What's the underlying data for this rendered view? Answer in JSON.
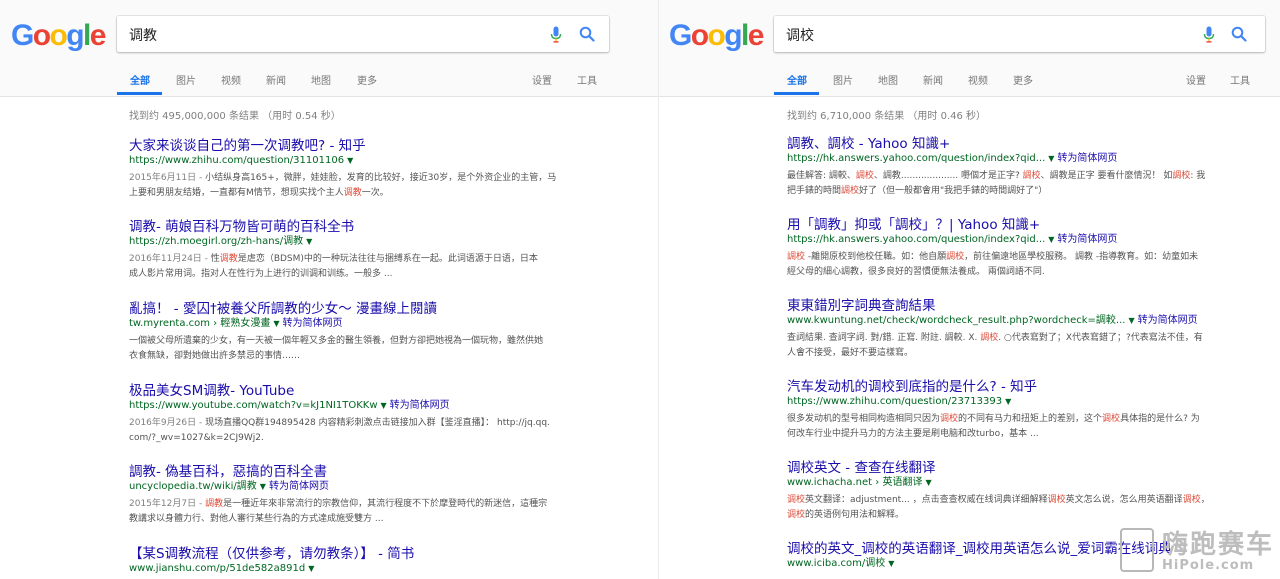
{
  "brand": {
    "logo_letters": [
      "G",
      "o",
      "o",
      "g",
      "l",
      "e"
    ],
    "logo_colors": [
      "#4285f4",
      "#ea4335",
      "#fbbc05",
      "#4285f4",
      "#34a853",
      "#ea4335"
    ],
    "accent": "#1a73e8",
    "link_color": "#1a0dab",
    "url_color": "#006621",
    "highlight_color": "#dd4b39"
  },
  "left": {
    "query": "调教",
    "tabs": [
      "全部",
      "图片",
      "视频",
      "新闻",
      "地图",
      "更多"
    ],
    "settings": "设置",
    "tools": "工具",
    "stats": "找到约 495,000,000 条结果 （用时 0.54 秒）",
    "results": [
      {
        "title": "大家来谈谈自己的第一次调教吧? - 知乎",
        "url": "https://www.zhihu.com/question/31101106",
        "translate": "",
        "date": "2015年6月11日 - ",
        "snippet_lines": [
          [
            {
              "t": "小结纵身高165+，微胖，娃娃脸，发育的比较好，接近30岁，是个外资企业的主管，马"
            }
          ],
          [
            {
              "t": "上要和男朋友结婚，一直都有M情节，想现实找个主人"
            },
            {
              "t": "调教",
              "h": true
            },
            {
              "t": "一次。"
            }
          ]
        ]
      },
      {
        "title": "调教- 萌娘百科万物皆可萌的百科全书",
        "url": "https://zh.moegirl.org/zh-hans/调教",
        "translate": "",
        "date": "2016年11月24日 - ",
        "snippet_lines": [
          [
            {
              "t": "性"
            },
            {
              "t": "调教",
              "h": true
            },
            {
              "t": "是虐恋（BDSM)中的一种玩法往往与捆缚系在一起。此词语源于日语，日本"
            }
          ],
          [
            {
              "t": "成人影片常用词。指对人在性行为上进行的训调和训练。一般多 ..."
            }
          ]
        ]
      },
      {
        "title": "亂搞！ - 愛囚†被養父所調教的少女～ 漫畫線上閱讀",
        "url": "tw.myrenta.com › 輕熟女漫畫",
        "translate": "转为简体网页",
        "date": "",
        "snippet_lines": [
          [
            {
              "t": "一個被父母所遺棄的少女，有一天被一個年輕又多金的醫生領養，但對方卻把她視為一個玩物，雖然供她"
            }
          ],
          [
            {
              "t": "衣食無缺，卻對她做出許多禁忌的事情……"
            }
          ]
        ]
      },
      {
        "title": "极品美女SM调教- YouTube",
        "url": "https://www.youtube.com/watch?v=kJ1NI1TOKKw",
        "translate": "转为简体网页",
        "date": "2016年9月26日 - ",
        "snippet_lines": [
          [
            {
              "t": "现场直播QQ群194895428 内容精彩刺激点击链接加入群【鉴淫直播】： http://jq.qq."
            }
          ],
          [
            {
              "t": "com/?_wv=1027&k=2CJ9Wj2."
            }
          ]
        ]
      },
      {
        "title": "調教- 偽基百科，惡搞的百科全書",
        "url": "uncyclopedia.tw/wiki/調教",
        "translate": "转为简体网页",
        "date": "2015年12月7日 - ",
        "snippet_lines": [
          [
            {
              "t": "調教",
              "h": true
            },
            {
              "t": "是一種近年來非常流行的宗教信仰，其流行程度不下於摩登時代的新迷信，這種宗"
            }
          ],
          [
            {
              "t": "教講求以身體力行、對他人審行某些行為的方式達成施受雙方 ..."
            }
          ]
        ]
      },
      {
        "title": "【某S调教流程（仅供参考，请勿教条）】 - 简书",
        "url": "www.jianshu.com/p/51de582a891d",
        "translate": "",
        "date": "",
        "snippet_lines": []
      }
    ]
  },
  "right": {
    "query": "调校",
    "tabs": [
      "全部",
      "图片",
      "地图",
      "新闻",
      "视频",
      "更多"
    ],
    "settings": "设置",
    "tools": "工具",
    "stats": "找到约 6,710,000 条结果 （用时 0.46 秒）",
    "results": [
      {
        "title": "調教、調校 - Yahoo 知識+",
        "url": "https://hk.answers.yahoo.com/question/index?qid...",
        "translate": "转为简体网页",
        "date": "",
        "snippet_lines": [
          [
            {
              "t": "最佳解答: 調較、"
            },
            {
              "t": "調校",
              "h": true
            },
            {
              "t": "、調教.................... 嘢個才是正字? "
            },
            {
              "t": "調校",
              "h": true
            },
            {
              "t": "、調教是正字 要看什麼情況！ 如"
            },
            {
              "t": "調校",
              "h": true
            },
            {
              "t": ": 我"
            }
          ],
          [
            {
              "t": "把手錶的時間"
            },
            {
              "t": "調校",
              "h": true
            },
            {
              "t": "好了（但一般都會用\"我把手錶的時間調好了\"）"
            }
          ]
        ]
      },
      {
        "title": "用「調教」抑或「調校」？| Yahoo 知識+",
        "url": "https://hk.answers.yahoo.com/question/index?qid...",
        "translate": "转为简体网页",
        "date": "",
        "snippet_lines": [
          [
            {
              "t": "調校",
              "h": true
            },
            {
              "t": " -離開原校到他校任職。如：他自願"
            },
            {
              "t": "調校",
              "h": true
            },
            {
              "t": "，前往偏遠地區學校服務。 調教 -指導教育。如：幼童如未"
            }
          ],
          [
            {
              "t": "經父母的細心調教，很多良好的習慣便無法養成。 兩個詞語不同."
            }
          ]
        ]
      },
      {
        "title": "東東錯別字詞典查詢結果",
        "url": "www.kwuntung.net/check/wordcheck_result.php?wordcheck=調較...",
        "translate": "转为简体网页",
        "date": "",
        "snippet_lines": [
          [
            {
              "t": "查詞結果. 查詞字詞. 對/錯. 正寫. 附註. 調較. X. "
            },
            {
              "t": "調校",
              "h": true
            },
            {
              "t": ". ○代表寫對了；X代表寫錯了；?代表寫法不佳，有"
            }
          ],
          [
            {
              "t": "人會不接受，最好不要這樣寫。"
            }
          ]
        ]
      },
      {
        "title": "汽车发动机的调校到底指的是什么? - 知乎",
        "url": "https://www.zhihu.com/question/23713393",
        "translate": "",
        "date": "",
        "snippet_lines": [
          [
            {
              "t": "很多发动机的型号相同构造相同只因为"
            },
            {
              "t": "调校",
              "h": true
            },
            {
              "t": "的不同有马力和扭矩上的差别，这个"
            },
            {
              "t": "调校",
              "h": true
            },
            {
              "t": "具体指的是什么? 为"
            }
          ],
          [
            {
              "t": "何改车行业中提升马力的方法主要是刷电脑和改turbo，基本 ..."
            }
          ]
        ]
      },
      {
        "title": "调校英文 - 查查在线翻译",
        "url": "www.ichacha.net › 英语翻译",
        "translate": "",
        "date": "",
        "snippet_lines": [
          [
            {
              "t": "调校",
              "h": true
            },
            {
              "t": "英文翻译：adjustment... ，点击查查权威在线词典详细解释"
            },
            {
              "t": "调校",
              "h": true
            },
            {
              "t": "英文怎么说，怎么用英语翻译"
            },
            {
              "t": "调校",
              "h": true
            },
            {
              "t": "，"
            }
          ],
          [
            {
              "t": "调校",
              "h": true
            },
            {
              "t": "的英语例句用法和解释。"
            }
          ]
        ]
      },
      {
        "title": "调校的英文_调校的英语翻译_调校用英语怎么说_爱词霸在线词典",
        "url": "www.iciba.com/调校",
        "translate": "",
        "date": "",
        "snippet_lines": []
      }
    ]
  },
  "watermark": {
    "cn": "嗨跑赛车",
    "en": "HiPole.com"
  }
}
